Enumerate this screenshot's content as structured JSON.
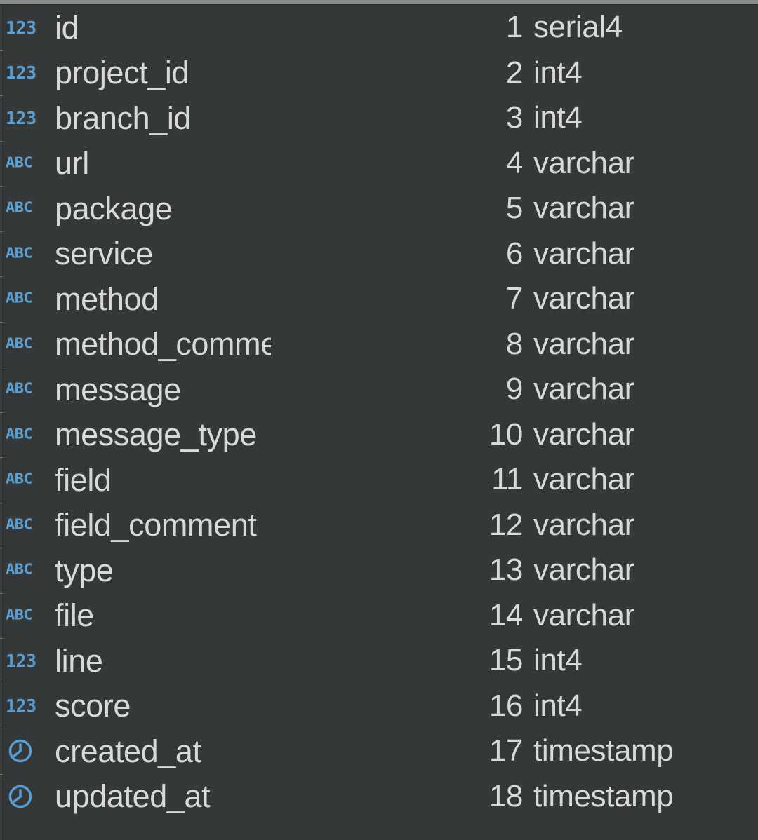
{
  "panel": {
    "name": "database-columns-list",
    "theme": "dark",
    "colors": {
      "background": "#343839",
      "text": "#d9d9d9",
      "accent_blue": "#5a9fd4",
      "header_strip": "#8a8d8e"
    },
    "icon_glyphs": {
      "numeric": "123",
      "text": "ABC",
      "timestamp": "clock"
    }
  },
  "columns": [
    {
      "icon": "numeric",
      "icon_label": "123",
      "name": "id",
      "display_name": "id",
      "ordinal": "1",
      "data_type": "serial4"
    },
    {
      "icon": "numeric",
      "icon_label": "123",
      "name": "project_id",
      "display_name": "project_id",
      "ordinal": "2",
      "data_type": "int4"
    },
    {
      "icon": "numeric",
      "icon_label": "123",
      "name": "branch_id",
      "display_name": "branch_id",
      "ordinal": "3",
      "data_type": "int4"
    },
    {
      "icon": "text",
      "icon_label": "ABC",
      "name": "url",
      "display_name": "url",
      "ordinal": "4",
      "data_type": "varchar"
    },
    {
      "icon": "text",
      "icon_label": "ABC",
      "name": "package",
      "display_name": "package",
      "ordinal": "5",
      "data_type": "varchar"
    },
    {
      "icon": "text",
      "icon_label": "ABC",
      "name": "service",
      "display_name": "service",
      "ordinal": "6",
      "data_type": "varchar"
    },
    {
      "icon": "text",
      "icon_label": "ABC",
      "name": "method",
      "display_name": "method",
      "ordinal": "7",
      "data_type": "varchar"
    },
    {
      "icon": "text",
      "icon_label": "ABC",
      "name": "method_comment",
      "display_name": "method_comment",
      "ordinal": "8",
      "data_type": "varchar"
    },
    {
      "icon": "text",
      "icon_label": "ABC",
      "name": "message",
      "display_name": "message",
      "ordinal": "9",
      "data_type": "varchar"
    },
    {
      "icon": "text",
      "icon_label": "ABC",
      "name": "message_type",
      "display_name": "message_type",
      "ordinal": "10",
      "data_type": "varchar"
    },
    {
      "icon": "text",
      "icon_label": "ABC",
      "name": "field",
      "display_name": "field",
      "ordinal": "11",
      "data_type": "varchar"
    },
    {
      "icon": "text",
      "icon_label": "ABC",
      "name": "field_comment",
      "display_name": "field_comment",
      "ordinal": "12",
      "data_type": "varchar"
    },
    {
      "icon": "text",
      "icon_label": "ABC",
      "name": "type",
      "display_name": "type",
      "ordinal": "13",
      "data_type": "varchar"
    },
    {
      "icon": "text",
      "icon_label": "ABC",
      "name": "file",
      "display_name": "file",
      "ordinal": "14",
      "data_type": "varchar"
    },
    {
      "icon": "numeric",
      "icon_label": "123",
      "name": "line",
      "display_name": "line",
      "ordinal": "15",
      "data_type": "int4"
    },
    {
      "icon": "numeric",
      "icon_label": "123",
      "name": "score",
      "display_name": "score",
      "ordinal": "16",
      "data_type": "int4"
    },
    {
      "icon": "timestamp",
      "icon_label": "",
      "name": "created_at",
      "display_name": "created_at",
      "ordinal": "17",
      "data_type": "timestamp"
    },
    {
      "icon": "timestamp",
      "icon_label": "",
      "name": "updated_at",
      "display_name": "updated_at",
      "ordinal": "18",
      "data_type": "timestamp"
    }
  ]
}
